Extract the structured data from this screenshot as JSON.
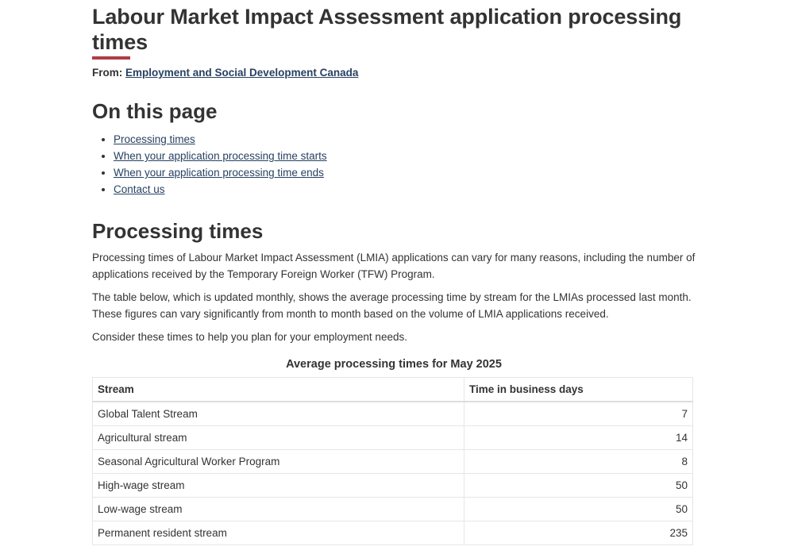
{
  "page": {
    "title": "Labour Market Impact Assessment application processing times",
    "from_label": "From:",
    "from_link": "Employment and Social Development Canada"
  },
  "on_this_page": {
    "heading": "On this page",
    "items": [
      "Processing times",
      "When your application processing time starts",
      "When your application processing time ends",
      "Contact us"
    ]
  },
  "processing_times": {
    "heading": "Processing times",
    "paragraphs": [
      "Processing times of Labour Market Impact Assessment (LMIA) applications can vary for many reasons, including the number of applications received by the Temporary Foreign Worker (TFW) Program.",
      "The table below, which is updated monthly, shows the average processing time by stream for the LMIAs processed last month. These figures can vary significantly from month to month based on the volume of LMIA applications received.",
      "Consider these times to help you plan for your employment needs."
    ],
    "table": {
      "caption": "Average processing times for May 2025",
      "headers": [
        "Stream",
        "Time in business days"
      ],
      "rows": [
        {
          "stream": "Global Talent Stream",
          "days": "7"
        },
        {
          "stream": "Agricultural stream",
          "days": "14"
        },
        {
          "stream": "Seasonal Agricultural Worker Program",
          "days": "8"
        },
        {
          "stream": "High-wage stream",
          "days": "50"
        },
        {
          "stream": "Low-wage stream",
          "days": "50"
        },
        {
          "stream": "Permanent resident stream",
          "days": "235"
        }
      ]
    }
  },
  "colors": {
    "link": "#284162",
    "title_accent": "#af3c43",
    "text": "#333333"
  }
}
